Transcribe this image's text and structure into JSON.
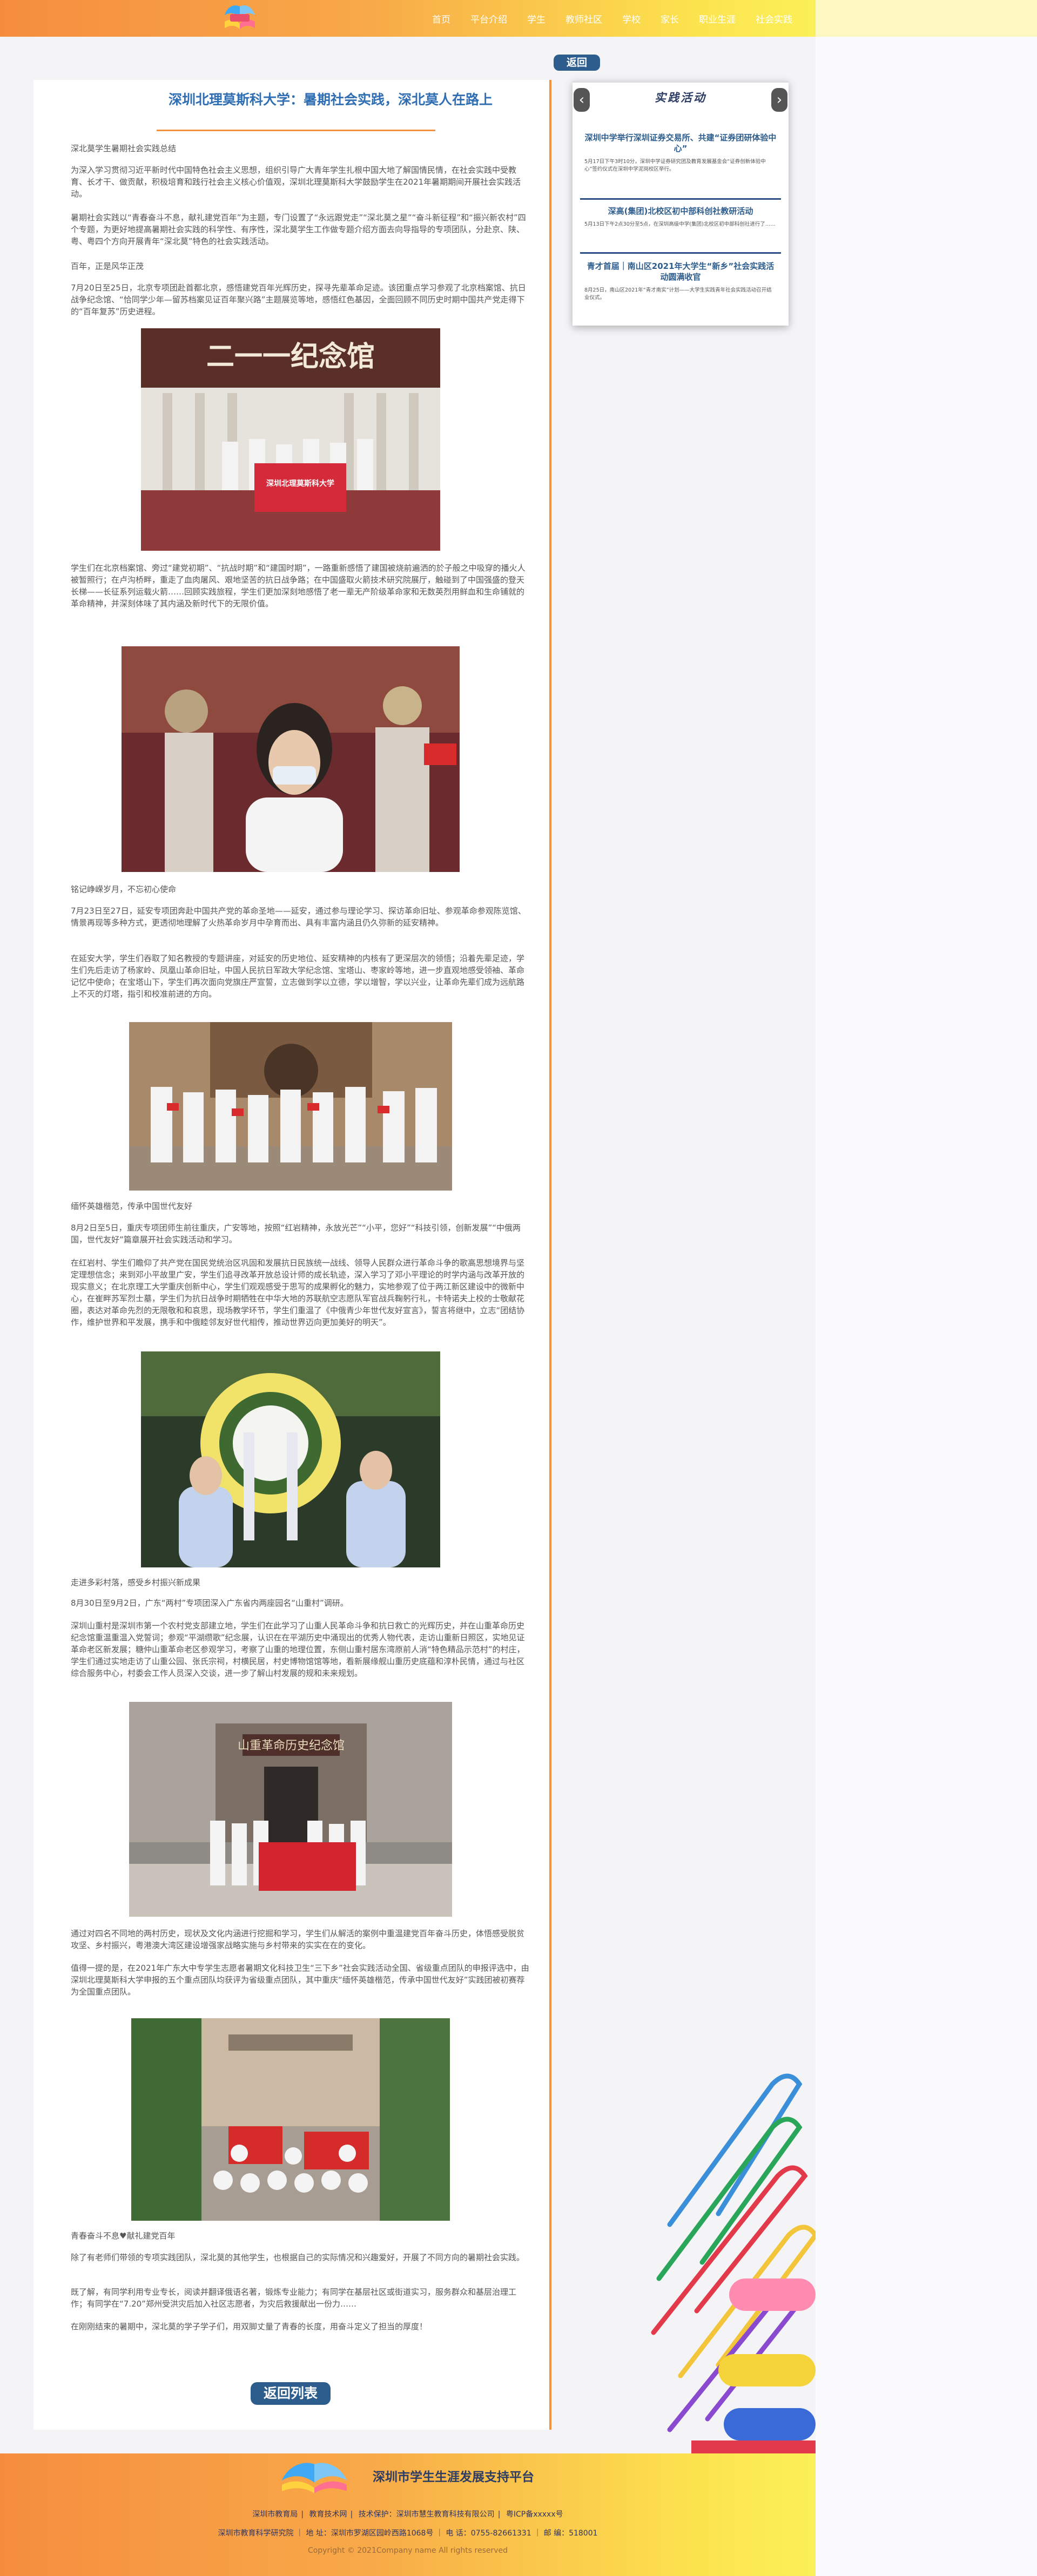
{
  "header": {
    "nav": [
      "首页",
      "平台介绍",
      "学生",
      "教师社区",
      "学校",
      "家长",
      "职业生涯",
      "社会实践"
    ]
  },
  "back_top_label": "返回",
  "article": {
    "title": "深圳北理莫斯科大学：暑期社会实践，深北莫人在路上",
    "paragraphs": [
      "深北莫学生暑期社会实践总结",
      "为深入学习贯彻习近平新时代中国特色社会主义思想，组织引导广大青年学生扎根中国大地了解国情民情，在社会实践中受教育、长才干、做贡献，积极培育和践行社会主义核心价值观，深圳北理莫斯科大学鼓励学生在2021年暑期期间开展社会实践活动。",
      "暑期社会实践以“青春奋斗不息，献礼建党百年”为主题，专门设置了“永远跟党走”“深北莫之星”“奋斗新征程”和“振兴新农村”四个专题，为更好地提高暑期社会实践的科学性、有序性，深北莫学生工作做专题介绍方面去向导指导的专项团队，分赴京、陕、粤、粤四个方向开展青年“深北莫”特色的社会实践活动。",
      "百年，正是风华正茂",
      "7月20日至25日，北京专项团赴首都北京，感悟建党百年光辉历史，探寻先辈革命足迹。该团重点学习参观了北京档案馆、抗日战争纪念馆、“恰同学少年—留苏档案见证百年聚兴路”主题展览等地，感悟红色基因，全面回顾不同历史时期中国共产党走得下的“百年复苏”历史进程。",
      "学生们在北京档案馆、旁过“建党初期”、“抗战时期”和“建国时期”，一路重新感悟了建国被烧前遍洒的於子般之中吸穿的播火人被暂照行；在卢沟桥畔，重走了血肉屠风、艰地坚苦的抗日战争路；在中国盛取火箭技术研究院展厅，触碰到了中国强盛的登天长梯——长征系列运载火箭……回顾实践旅程，学生们更加深刻地感悟了老一辈无产阶级革命家和无数英烈用鲜血和生命铺就的革命精神，并深刻体味了其内涵及新时代下的无限价值。",
      "铭记峥嵘岁月，不忘初心使命",
      "7月23日至27日，延安专项团奔赴中国共产党的革命圣地——延安，通过参与理论学习、探访革命旧址、参观革命参观陈览馆、情景再现等多种方式，更透彻地理解了火热革命岁月中孕育而出、具有丰富内涵且仍久弥新的延安精神。",
      "在延安大学，学生们吞取了知名教授的专题讲座，对延安的历史地位、延安精神的内核有了更深层次的领悟；沿着先辈足迹，学生们先后走访了杨家岭、凤凰山革命旧址，中国人民抗日军政大学纪念馆、宝塔山、枣家岭等地，进一步直观地感受领袖、革命记忆中使命；在宝塔山下，学生们再次面向党旗庄严宣誓，立志做到学以立德，学以增智，学以兴业，让革命先辈们成为远航路上不灭的灯塔，指引和校准前进的方向。",
      "缅怀英雄楷范，传承中国世代友好",
      "8月2日至5日，重庆专项团师生前往重庆，广安等地，按照“红岩精神，永放光芒”“小平，您好”“科技引领，创新发展”“中俄两国，世代友好”篇章展开社会实践活动和学习。",
      "在红岩村、学生们瞻仰了共产党在国民党统治区巩固和发展抗日民族统一战线、领导人民群众进行革命斗争的歌高思想境界与坚定理想信念；来到邓小平故里广安，学生们追寻改革开放总设计师的成长轨迹，深入学习了邓小平理论的时学内涵与改革开放的现实意义；在北京理工大学重庆创新中心，学生们观观感受于思写的成果孵化的魅力，实地参观了位于两江新区建设中的微新中心，在崔畔苏军烈士墓，学生们为抗日战争时期牺牲在中华大地的苏联航空志愿队军官战兵鞠躬行礼，卡特诺夫上校的士敬献花圈，表达对革命先烈的无限敬和和哀思，现场教学环节，学生们重温了《中俄青少年世代友好宣言》，誓言将继中，立志“团结协作，维护世界和平发展，携手和中俄睦邻友好世代相传，推动世界迈向更加美好的明天”。",
      "走进多彩村落，感受乡村振兴新成果",
      "8月30日至9月2日，广东“两村”专项团深入广东省内两座园名“山重村”调研。",
      "深圳山重村是深圳市第一个农村党支部建立地，学生们在此学习了山重人民革命斗争和抗日救亡的光辉历史，并在山重革命历史纪念馆重温重温入党誓词；参观“平湖缵歌”纪念展，认识在在平湖历史中涌现出的优秀人物代表，走访山重新日照区，实地见证革命老区新发展；糖仲山重革命老区参观学习，考察了山重的地理位置，东侧山重村居东湾原前人消“特色精品示范村”的村庄，学生们通过实地走访了山重公园、张氏宗祠，村横民居，村史博物馆馆等地，看新展缘舰山重历史底蕴和淳朴民情，通过与社区综合服务中心，村委会工作人员深入交谈，进一步了解山村发展的规和未来规划。",
      "通过对四名不同地的两村历史，现状及文化内涵进行挖掘和学习，学生们从解活的案例中重温建党百年奋斗历史，体悟感受脱贫攻坚、乡村振兴，粤港澳大湾区建设增强家战略实施与乡村带来的实实在在的变化。",
      "值得一提的是，在2021年广东大中专学生志愿者暑期文化科技卫生“三下乡”社会实践活动全国、省级重点团队的申报评选中，由深圳北理莫斯科大学申报的五个重点团队均获评为省级重点团队，其中重庆“缅怀英雄楷范，传承中国世代友好”实践团被初赛荐为全国重点团队。",
      "青春奋斗不息♥献礼建党百年",
      "除了有老师们带领的专项实践团队，深北莫的其他学生，也根据自己的实际情况和兴趣爱好，开展了不同方向的暑期社会实践。",
      "既了解，有同学利用专业专长，阅读并翻译俄语名著，锻炼专业能力；有同学在基层社区或街道实习，服务群众和基层治理工作；有同学在“7.20”郑州受洪灾后加入社区志愿者，为灾后救援献出一份力……",
      "在刚刚结束的暑期中，深北莫的学子学子们，用双脚丈量了青春的长度，用奋斗定义了担当的厚度！"
    ],
    "back_list_label": "返回列表"
  },
  "sidebar": {
    "title": "实践活动",
    "prev_icon": "chevron-left-icon",
    "next_icon": "chevron-right-icon",
    "items": [
      {
        "title": "深圳中学举行深圳证券交易所、共建“证券团研体验中心”",
        "desc": "5月17日下午3时10分，深圳中学证券研究团及教育发展基金会“证券创新体验中心”签约仪式在深圳中学泥岗校区举行。"
      },
      {
        "title": "深高(集团)北校区初中部科创社教研活动",
        "desc": "5月13日下午2点30分至5点，在深圳高级中学(集团)北校区初中部科创社进行了……"
      },
      {
        "title": "青才首届｜南山区2021年大学生“新乡”社会实践活动圆满收官",
        "desc": "8月25日，南山区2021年“青才南实”计划——大学生实践青年社会实践活动召开结业仪式。"
      }
    ]
  },
  "footer": {
    "title": "深圳市学生生涯发展支持平台",
    "links": [
      "深圳市教育局",
      "教育技术网",
      "技术保护：深圳市慧生教育科技有限公司",
      "粤ICP备xxxxx号"
    ],
    "info": "深圳市教育科学研究院 ｜ 地 址：深圳市罗湖区园岭西路1068号 ｜ 电 话：0755-82661331 ｜ 邮 编：518001",
    "copyright": "Copyright © 2021Company name All rights reserved"
  }
}
